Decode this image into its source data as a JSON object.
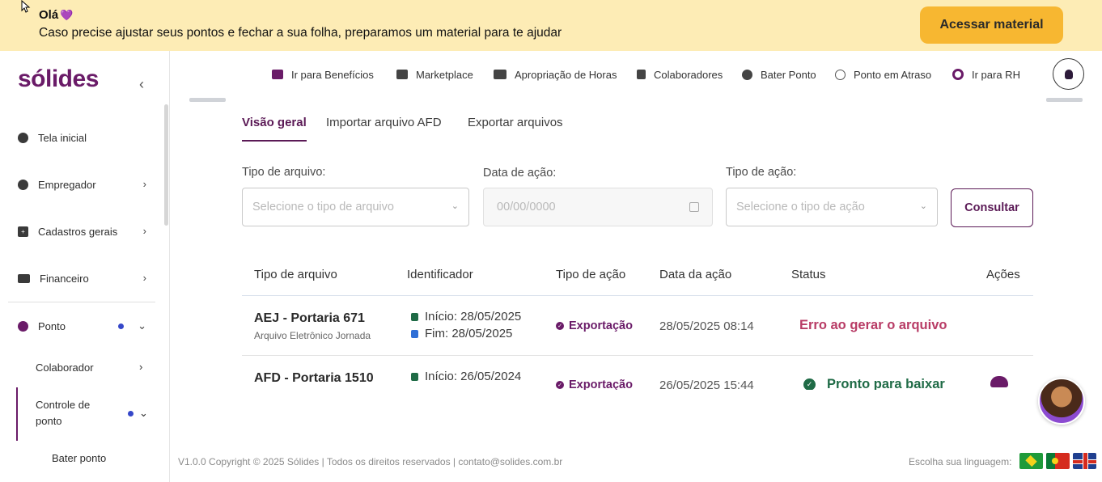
{
  "banner": {
    "hello": "Olá",
    "message": "Caso precise ajustar seus pontos e fechar a sua folha, preparamos um material para te ajudar",
    "button": "Acessar material"
  },
  "sidebar": {
    "logo": "sólides",
    "items": [
      {
        "label": "Tela inicial",
        "icon": "globe-icon"
      },
      {
        "label": "Empregador",
        "icon": "user-circle-icon"
      },
      {
        "label": "Cadastros gerais",
        "icon": "plus-square-icon"
      },
      {
        "label": "Financeiro",
        "icon": "money-icon"
      },
      {
        "label": "Ponto",
        "icon": "clock-icon"
      }
    ],
    "subitems": {
      "colaborador": "Colaborador",
      "controle_line1": "Controle de",
      "controle_line2": "ponto",
      "bater_ponto": "Bater ponto"
    }
  },
  "topnav": [
    {
      "label": "Ir para Benefícios",
      "icon": "wallet-icon"
    },
    {
      "label": "Marketplace",
      "icon": "cart-icon"
    },
    {
      "label": "Apropriação de Horas",
      "icon": "users-icon"
    },
    {
      "label": "Colaboradores",
      "icon": "book-icon"
    },
    {
      "label": "Bater Ponto",
      "icon": "clock-icon"
    },
    {
      "label": "Ponto em Atraso",
      "icon": "history-icon"
    },
    {
      "label": "Ir para RH",
      "icon": "solides-icon"
    }
  ],
  "tabs": [
    "Visão geral",
    "Importar arquivo AFD",
    "Exportar arquivos"
  ],
  "filters": {
    "tipo_arquivo": {
      "label": "Tipo de arquivo:",
      "placeholder": "Selecione o tipo de arquivo"
    },
    "data_acao": {
      "label": "Data de ação:",
      "placeholder": "00/00/0000"
    },
    "tipo_acao": {
      "label": "Tipo de ação:",
      "placeholder": "Selecione o tipo de ação"
    },
    "button": "Consultar"
  },
  "table": {
    "headers": [
      "Tipo de arquivo",
      "Identificador",
      "Tipo de ação",
      "Data da ação",
      "Status",
      "Ações"
    ],
    "rows": [
      {
        "title": "AEJ - Portaria 671",
        "subtitle": "Arquivo Eletrônico Jornada",
        "start": "Início: 28/05/2025",
        "end": "Fim: 28/05/2025",
        "action": "Exportação",
        "date": "28/05/2025 08:14",
        "status": "Erro ao gerar o arquivo"
      },
      {
        "title": "AFD - Portaria 1510",
        "start": "Início: 26/05/2024",
        "action": "Exportação",
        "date": "26/05/2025 15:44",
        "status": "Pronto para baixar"
      }
    ]
  },
  "footer": {
    "copyright": "V1.0.0 Copyright © 2025 Sólides | Todos os direitos reservados | contato@solides.com.br",
    "language_label": "Escolha sua linguagem:"
  },
  "colors": {
    "brand": "#6a1b68",
    "banner_bg": "#fdecb5",
    "banner_button": "#f7b731",
    "error": "#b83c66",
    "success": "#1f6b46"
  }
}
